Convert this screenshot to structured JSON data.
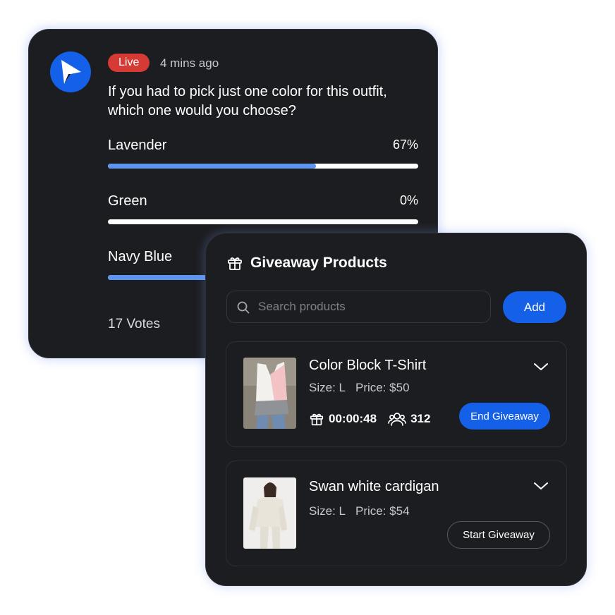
{
  "poll": {
    "live_label": "Live",
    "time_ago": "4 mins ago",
    "question": "If you had to pick just one color for this outfit, which one would you choose?",
    "options": [
      {
        "label": "Lavender",
        "percent_label": "67%",
        "fill": 0.67
      },
      {
        "label": "Green",
        "percent_label": "0%",
        "fill": 0.0
      },
      {
        "label": "Navy Blue",
        "percent_label": "",
        "fill": 0.33
      }
    ],
    "votes": "17 Votes",
    "colors": {
      "accent": "#1560e8",
      "bar_fill": "#5d94f0",
      "live": "#d63a35"
    }
  },
  "giveaway": {
    "title": "Giveaway Products",
    "search_placeholder": "Search products",
    "add_label": "Add",
    "products": [
      {
        "name": "Color Block T-Shirt",
        "size": "Size: L",
        "price": "Price: $50",
        "timer": "00:00:48",
        "participants": "312",
        "action": "End Giveaway"
      },
      {
        "name": "Swan white cardigan",
        "size": "Size: L",
        "price": "Price: $54",
        "action": "Start Giveaway"
      }
    ]
  },
  "icons": [
    "cursor-logo-icon",
    "gift-icon",
    "search-icon",
    "chevron-down-icon",
    "users-icon"
  ]
}
